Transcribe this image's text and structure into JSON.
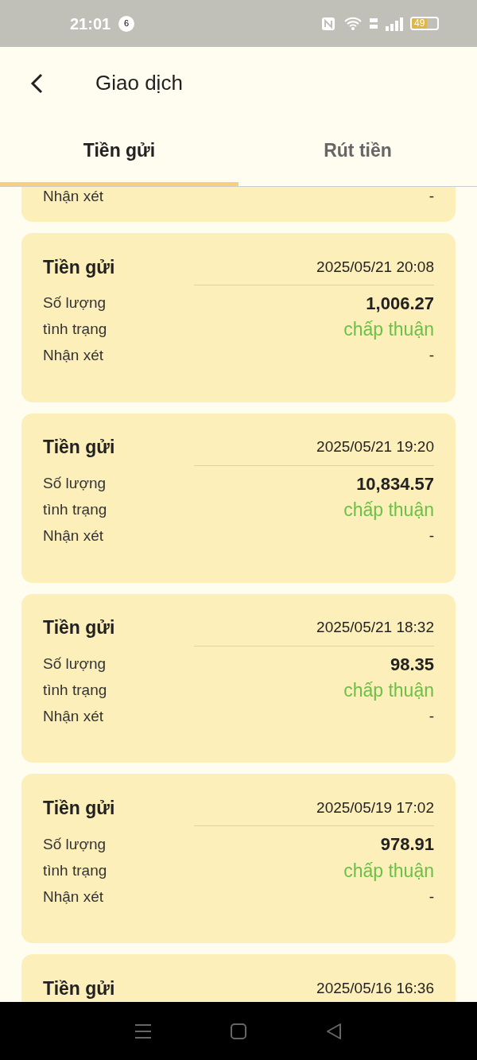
{
  "status_bar": {
    "time": "21:01",
    "notification_count": "6",
    "battery": "49"
  },
  "header": {
    "title": "Giao dịch"
  },
  "tabs": [
    {
      "label": "Tiền gửi",
      "selected": true
    },
    {
      "label": "Rút tiền",
      "selected": false
    }
  ],
  "transactions": [
    {
      "kind": "partial",
      "remark_label": "Nhận xét",
      "remark": "-"
    },
    {
      "kind": "full",
      "type": "Tiền gửi",
      "date": "2025/05/21 20:08",
      "amount_label": "Số lượng",
      "amount": "1,006.27",
      "status_label": "tình trạng",
      "status": "chấp thuận",
      "remark_label": "Nhận xét",
      "remark": "-"
    },
    {
      "kind": "full",
      "type": "Tiền gửi",
      "date": "2025/05/21 19:20",
      "amount_label": "Số lượng",
      "amount": "10,834.57",
      "status_label": "tình trạng",
      "status": "chấp thuận",
      "remark_label": "Nhận xét",
      "remark": "-"
    },
    {
      "kind": "full",
      "type": "Tiền gửi",
      "date": "2025/05/21 18:32",
      "amount_label": "Số lượng",
      "amount": "98.35",
      "status_label": "tình trạng",
      "status": "chấp thuận",
      "remark_label": "Nhận xét",
      "remark": "-"
    },
    {
      "kind": "full",
      "type": "Tiền gửi",
      "date": "2025/05/19 17:02",
      "amount_label": "Số lượng",
      "amount": "978.91",
      "status_label": "tình trạng",
      "status": "chấp thuận",
      "remark_label": "Nhận xét",
      "remark": "-"
    },
    {
      "kind": "header_only",
      "type": "Tiền gửi",
      "date": "2025/05/16 16:36"
    }
  ]
}
